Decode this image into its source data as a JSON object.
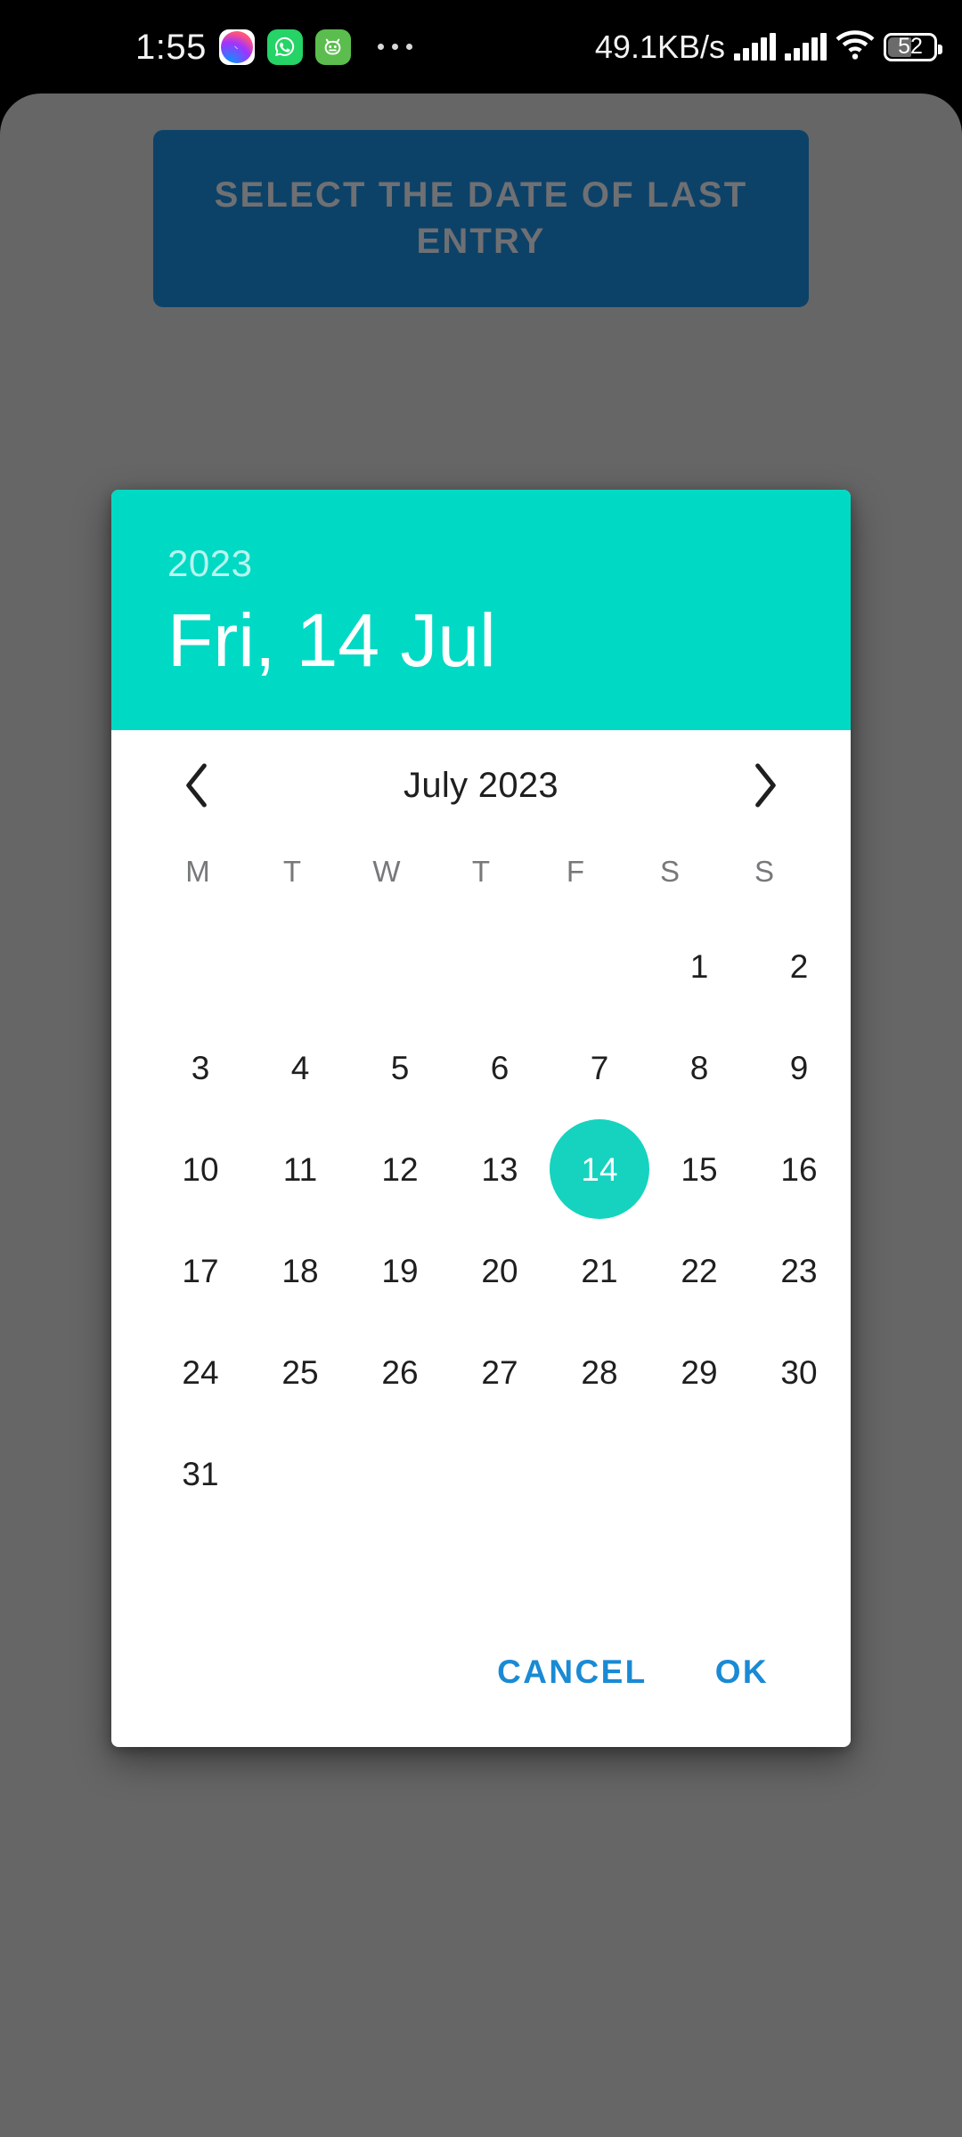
{
  "status_bar": {
    "clock": "1:55",
    "icons": [
      {
        "name": "messenger-icon",
        "label": "Messenger"
      },
      {
        "name": "whatsapp-icon",
        "label": "WhatsApp"
      },
      {
        "name": "green-app-icon",
        "label": "App"
      }
    ],
    "overflow": "···",
    "network_speed": "49.1KB/s",
    "signal_1": "signal-bars-icon",
    "signal_2": "signal-bars-icon",
    "wifi": "wifi-icon",
    "battery_level": "52"
  },
  "app": {
    "select_date_button": "SELECT THE DATE OF LAST ENTRY",
    "button_color": "#0d4268",
    "scrim_color": "#666666"
  },
  "dialog": {
    "accent_color": "#00d9c4",
    "action_color": "#1a8ad4",
    "header": {
      "year": "2023",
      "date": "Fri, 14 Jul"
    },
    "month_nav": {
      "prev_icon": "chevron-left-icon",
      "next_icon": "chevron-right-icon",
      "label": "July 2023"
    },
    "weekdays": [
      "M",
      "T",
      "W",
      "T",
      "F",
      "S",
      "S"
    ],
    "weeks": [
      [
        "",
        "",
        "",
        "",
        "",
        "1",
        "2"
      ],
      [
        "3",
        "4",
        "5",
        "6",
        "7",
        "8",
        "9"
      ],
      [
        "10",
        "11",
        "12",
        "13",
        "14",
        "15",
        "16"
      ],
      [
        "17",
        "18",
        "19",
        "20",
        "21",
        "22",
        "23"
      ],
      [
        "24",
        "25",
        "26",
        "27",
        "28",
        "29",
        "30"
      ],
      [
        "31",
        "",
        "",
        "",
        "",
        "",
        ""
      ]
    ],
    "selected_day": "14",
    "actions": {
      "cancel": "CANCEL",
      "ok": "OK"
    }
  }
}
